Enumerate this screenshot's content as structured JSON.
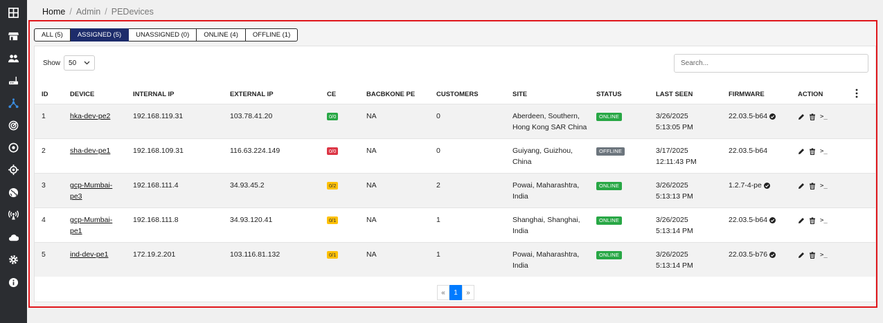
{
  "sidebar": {
    "icons": [
      "dashboard-grid-icon",
      "store-icon",
      "users-icon",
      "router-icon",
      "network-topology-icon",
      "radar-icon",
      "target-icon",
      "crosshair-icon",
      "globe-icon",
      "antenna-icon",
      "cloud-icon",
      "gear-icon",
      "info-icon"
    ]
  },
  "breadcrumb": {
    "home": "Home",
    "admin": "Admin",
    "current": "PEDevices"
  },
  "tabs": [
    {
      "label": "ALL (5)",
      "active": false
    },
    {
      "label": "ASSIGNED (5)",
      "active": true
    },
    {
      "label": "UNASSIGNED (0)",
      "active": false
    },
    {
      "label": "ONLINE (4)",
      "active": false
    },
    {
      "label": "OFFLINE (1)",
      "active": false
    }
  ],
  "controls": {
    "show_label": "Show",
    "show_value": "50",
    "search_placeholder": "Search..."
  },
  "columns": [
    "ID",
    "DEVICE",
    "INTERNAL IP",
    "EXTERNAL IP",
    "CE",
    "BACBKONE PE",
    "CUSTOMERS",
    "SITE",
    "STATUS",
    "LAST SEEN",
    "FIRMWARE",
    "ACTION"
  ],
  "rows": [
    {
      "id": "1",
      "device_l1": "hka-dev-pe2",
      "device_l2": "",
      "internal_ip": "192.168.119.31",
      "external_ip": "103.78.41.20",
      "ce": "0/0",
      "ce_color": "#28a745",
      "backbone": "NA",
      "customers": "0",
      "site_l1": "Aberdeen, Southern,",
      "site_l2": "Hong Kong SAR China",
      "status": "ONLINE",
      "last_seen_l1": "3/26/2025",
      "last_seen_l2": "5:13:05 PM",
      "firmware": "22.03.5-b64",
      "fw_verified": true
    },
    {
      "id": "2",
      "device_l1": "sha-dev-pe1",
      "device_l2": "",
      "internal_ip": "192.168.109.31",
      "external_ip": "116.63.224.149",
      "ce": "0/0",
      "ce_color": "#dc3545",
      "backbone": "NA",
      "customers": "0",
      "site_l1": "Guiyang, Guizhou,",
      "site_l2": "China",
      "status": "OFFLINE",
      "last_seen_l1": "3/17/2025",
      "last_seen_l2": "12:11:43 PM",
      "firmware": "22.03.5-b64",
      "fw_verified": false
    },
    {
      "id": "3",
      "device_l1": "gcp-Mumbai-",
      "device_l2": "pe3",
      "internal_ip": "192.168.111.4",
      "external_ip": "34.93.45.2",
      "ce": "0/2",
      "ce_color": "#ffc107",
      "backbone": "NA",
      "customers": "2",
      "site_l1": "Powai, Maharashtra,",
      "site_l2": "India",
      "status": "ONLINE",
      "last_seen_l1": "3/26/2025",
      "last_seen_l2": "5:13:13 PM",
      "firmware": "1.2.7-4-pe",
      "fw_verified": true
    },
    {
      "id": "4",
      "device_l1": "gcp-Mumbai-",
      "device_l2": "pe1",
      "internal_ip": "192.168.111.8",
      "external_ip": "34.93.120.41",
      "ce": "0/1",
      "ce_color": "#ffc107",
      "backbone": "NA",
      "customers": "1",
      "site_l1": "Shanghai, Shanghai,",
      "site_l2": "India",
      "status": "ONLINE",
      "last_seen_l1": "3/26/2025",
      "last_seen_l2": "5:13:14 PM",
      "firmware": "22.03.5-b64",
      "fw_verified": true
    },
    {
      "id": "5",
      "device_l1": "ind-dev-pe1",
      "device_l2": "",
      "internal_ip": "172.19.2.201",
      "external_ip": "103.116.81.132",
      "ce": "0/1",
      "ce_color": "#ffc107",
      "backbone": "NA",
      "customers": "1",
      "site_l1": "Powai, Maharashtra,",
      "site_l2": "India",
      "status": "ONLINE",
      "last_seen_l1": "3/26/2025",
      "last_seen_l2": "5:13:14 PM",
      "firmware": "22.03.5-b76",
      "fw_verified": true
    }
  ],
  "pagination": {
    "prev": "«",
    "current": "1",
    "next": "»"
  },
  "colors": {
    "active_tab": "#1d2c6b",
    "online": "#28a745",
    "offline": "#6c757d",
    "highlight": "#e0161b",
    "page_active": "#007bff"
  }
}
